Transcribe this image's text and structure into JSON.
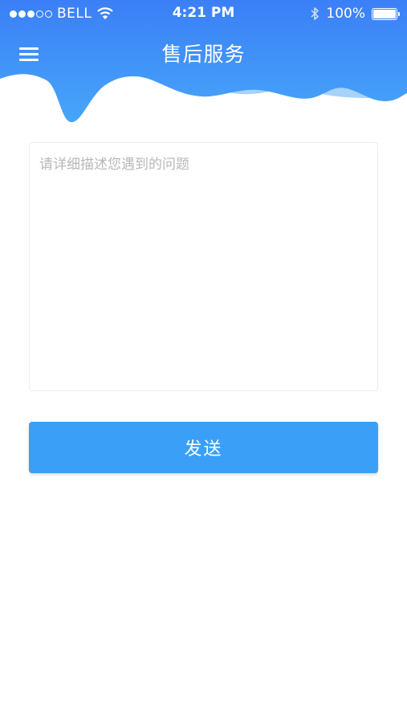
{
  "colors": {
    "header_top": "#3b7ff7",
    "header_bottom": "#47a6f8",
    "wave_light": "#a6d2fb",
    "accent": "#3aa0f7"
  },
  "status_bar": {
    "carrier": "BELL",
    "time": "4:21 PM",
    "battery": "100%",
    "battery_level": 1.0,
    "signal_bars_filled": 3,
    "signal_bars_total": 5
  },
  "header": {
    "title": "售后服务",
    "menu_icon": "hamburger-menu-icon"
  },
  "form": {
    "placeholder": "请详细描述您遇到的问题",
    "value": "",
    "send_label": "发送"
  }
}
